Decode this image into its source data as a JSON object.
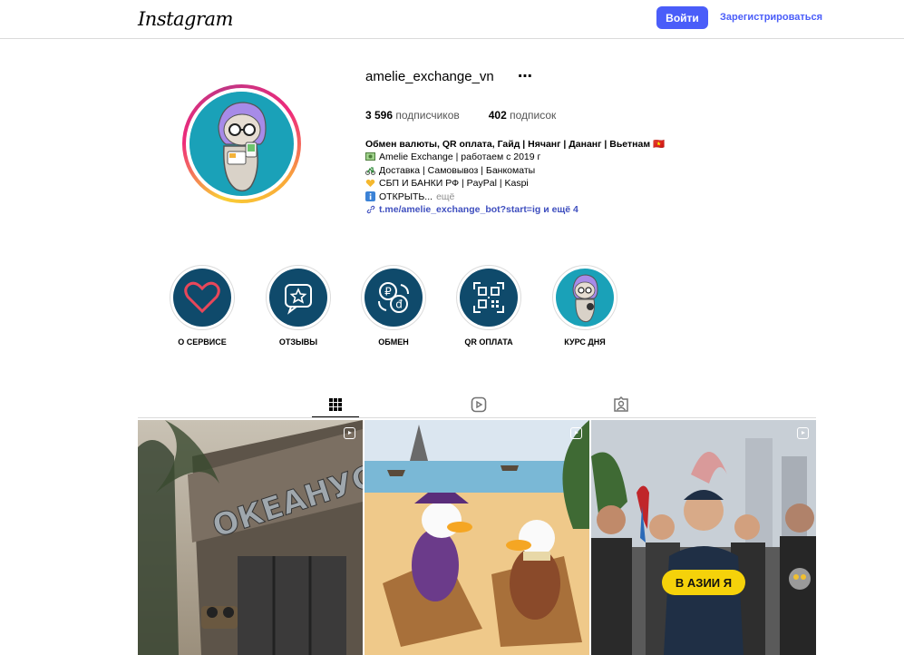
{
  "header": {
    "logo_text": "Instagram",
    "login_label": "Войти",
    "signup_label": "Зарегистрироваться",
    "accent": "#4a5df9"
  },
  "profile": {
    "username": "amelie_exchange_vn",
    "more_icon": "⋯",
    "followers_count": "3 596",
    "followers_label": "подписчиков",
    "following_count": "402",
    "following_label": "подписок",
    "bio_name": "Обмен валюты, QR оплата, Гайд | Нячанг | Дананг | Вьетнам 🇻🇳",
    "bio_lines": [
      {
        "icon": "money-icon",
        "text": "Amelie Exchange | работаем с 2019 г"
      },
      {
        "icon": "scooter-icon",
        "text": "Доставка | Самовывоз | Банкоматы"
      },
      {
        "icon": "heart-icon",
        "text": "СБП И БАНКИ РФ | PayPal | Kaspi"
      },
      {
        "icon": "info-icon",
        "text": "ОТКРЫТЬ..."
      }
    ],
    "bio_more": "ещё",
    "link_text": "t.me/amelie_exchange_bot?start=ig и ещё 4"
  },
  "highlights": [
    {
      "label": "О СЕРВИСЕ",
      "icon": "heart-icon"
    },
    {
      "label": "ОТЗЫВЫ",
      "icon": "star-message-icon"
    },
    {
      "label": "ОБМЕН",
      "icon": "currency-exchange-icon"
    },
    {
      "label": "QR ОПЛАТА",
      "icon": "qr-code-icon"
    },
    {
      "label": "КУРС ДНЯ",
      "icon": "avatar-icon"
    }
  ],
  "tabs": [
    {
      "name": "posts",
      "icon": "grid-icon",
      "active": true
    },
    {
      "name": "reels",
      "icon": "reels-icon",
      "active": false
    },
    {
      "name": "tagged",
      "icon": "tagged-icon",
      "active": false
    }
  ],
  "posts": [
    {
      "sign_text": "ОКЕАНУС"
    },
    {
      "sign_text": ""
    },
    {
      "sign_text": "В АЗИИ Я"
    }
  ]
}
